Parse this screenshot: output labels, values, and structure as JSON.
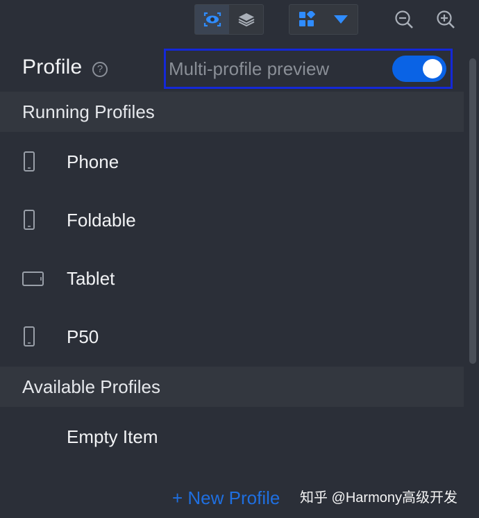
{
  "toolbar": {
    "view_group": [
      {
        "icon": "eye-scan-icon",
        "active": true
      },
      {
        "icon": "layers-icon",
        "active": false
      }
    ],
    "layout_group": [
      {
        "icon": "grid-blocks-icon"
      },
      {
        "icon": "triangle-down-icon"
      }
    ],
    "zoom_out_icon": "zoom-out-icon",
    "zoom_in_icon": "zoom-in-icon"
  },
  "header": {
    "title": "Profile",
    "help_symbol": "?",
    "multi_profile_label": "Multi-profile preview",
    "multi_profile_enabled": true
  },
  "running": {
    "section_title": "Running Profiles",
    "items": [
      {
        "label": "Phone",
        "icon": "phone-icon"
      },
      {
        "label": "Foldable",
        "icon": "phone-icon"
      },
      {
        "label": "Tablet",
        "icon": "tablet-icon"
      },
      {
        "label": "P50",
        "icon": "phone-icon"
      }
    ]
  },
  "available": {
    "section_title": "Available Profiles",
    "items": [
      {
        "label": "Empty Item"
      }
    ]
  },
  "actions": {
    "new_profile": "+ New Profile"
  },
  "watermark": "知乎 @Harmony高级开发",
  "colors": {
    "background": "#2b2f38",
    "section_bg": "#33373f",
    "accent": "#1f6fe0",
    "toggle_on": "#0a63e5",
    "focus_border": "#1428d8"
  }
}
